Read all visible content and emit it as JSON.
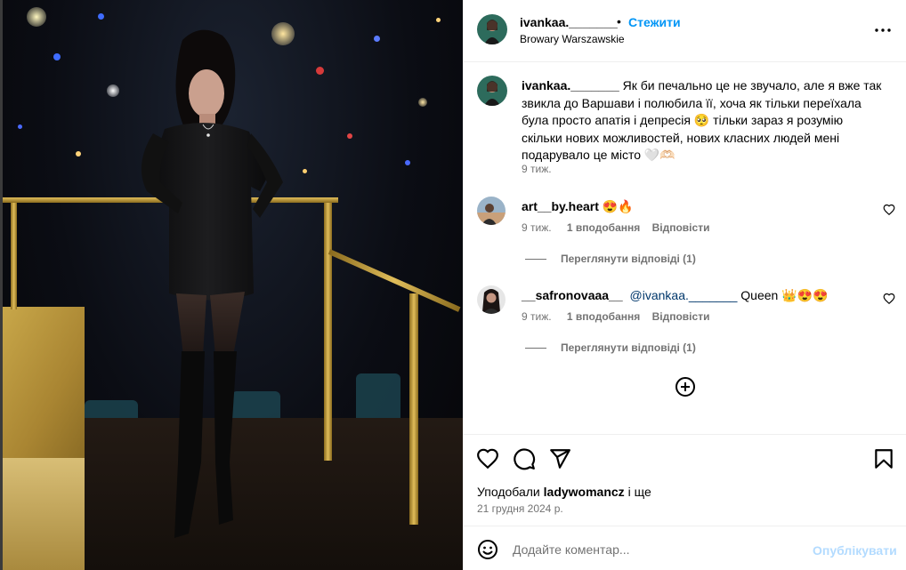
{
  "post": {
    "author": "ivankaa._______",
    "follow_label": "Стежити",
    "dot": "•",
    "location": "Browary Warszawskie"
  },
  "caption": {
    "author": "ivankaa._______",
    "text": "Як би печально це не звучало, але я вже так звикла до Варшави і полюбила її, хоча як тільки переїхала була просто апатія і депресія 🥺 тільки зараз я розумію скільки нових можливостей, нових класних людей мені подарувало це місто 🤍🫶🏻",
    "time": "9 тиж."
  },
  "comments": [
    {
      "user": "art__by.heart",
      "text": "😍🔥",
      "mention": "",
      "time": "9 тиж.",
      "likes": "1 вподобання",
      "reply": "Відповісти",
      "view_replies": "Переглянути відповіді (1)"
    },
    {
      "user": "__safronovaaa__",
      "mention": "@ivankaa._______",
      "text": " Queen 👑😍😍",
      "time": "9 тиж.",
      "likes": "1 вподобання",
      "reply": "Відповісти",
      "view_replies": "Переглянути відповіді (1)"
    }
  ],
  "icons": {
    "more": "more-options-icon",
    "like": "heart-icon",
    "comment": "comment-bubble-icon",
    "share": "paper-plane-icon",
    "save": "bookmark-icon",
    "load_more": "plus-circle-icon",
    "emoji": "smiley-icon"
  },
  "likes": {
    "prefix": "Уподобали ",
    "user": "ladywomancz",
    "suffix": " і ще"
  },
  "date": "21 грудня 2024 р.",
  "add_comment": {
    "placeholder": "Додайте коментар...",
    "publish_label": "Опублікувати"
  },
  "colors": {
    "accent": "#0095f6",
    "publish_disabled": "#b3dbff",
    "secondary_text": "#737373"
  }
}
